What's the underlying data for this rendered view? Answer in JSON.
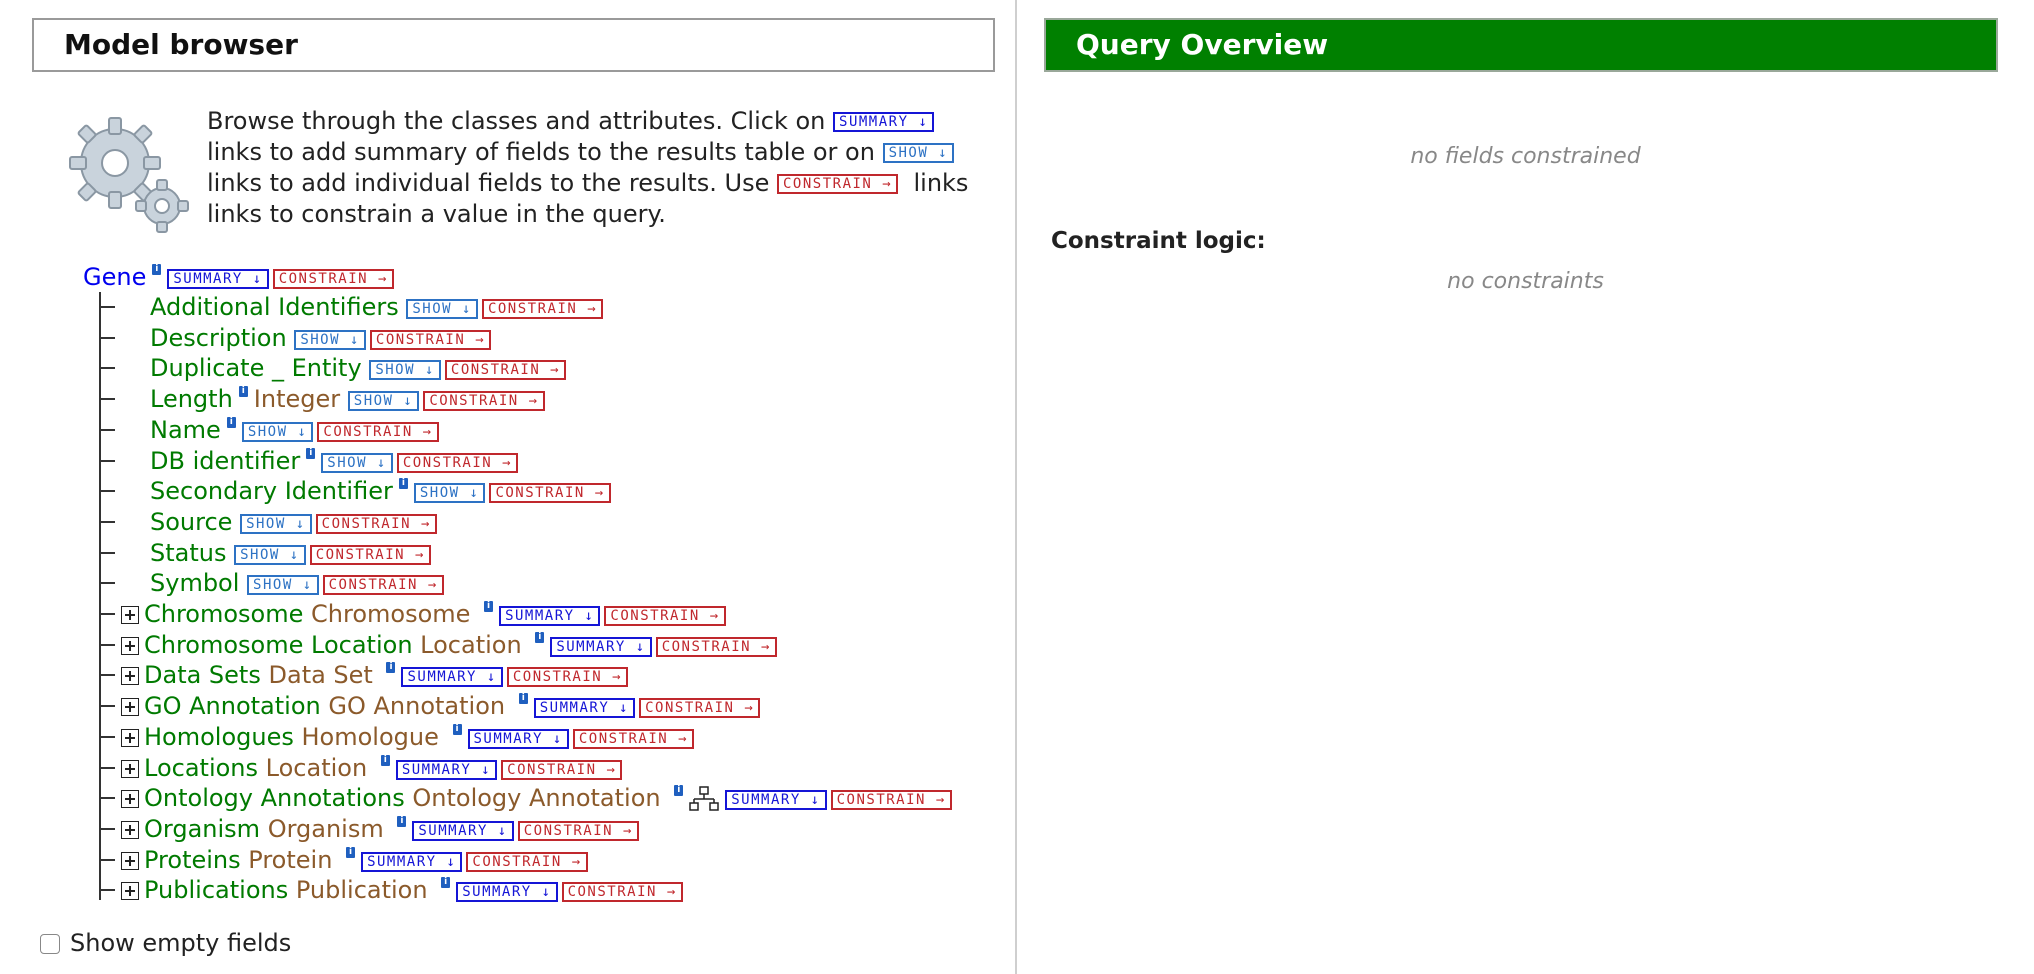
{
  "model_browser": {
    "title": "Model browser",
    "intro": {
      "part1": "Browse through the classes and attributes. Click on",
      "part2": "links to add summary of fields to the results table or on",
      "part3": "links to add individual fields to the results. Use",
      "part4": "links to constrain a value in the query."
    },
    "chips": {
      "summary": "SUMMARY ↓",
      "show": "SHOW ↓",
      "constrain": "CONSTRAIN →"
    },
    "root": {
      "label": "Gene"
    },
    "attributes": [
      {
        "name": "Additional Identifiers",
        "type": "",
        "info": false
      },
      {
        "name": "Description",
        "type": "",
        "info": false
      },
      {
        "name": "Duplicate _ Entity",
        "type": "",
        "info": false
      },
      {
        "name": "Length",
        "type": "Integer",
        "info": true
      },
      {
        "name": "Name",
        "type": "",
        "info": true
      },
      {
        "name": "DB identifier",
        "type": "",
        "info": true
      },
      {
        "name": "Secondary Identifier",
        "type": "",
        "info": true
      },
      {
        "name": "Source",
        "type": "",
        "info": false
      },
      {
        "name": "Status",
        "type": "",
        "info": false
      },
      {
        "name": "Symbol",
        "type": "",
        "info": false
      }
    ],
    "references": [
      {
        "name": "Chromosome",
        "type": "Chromosome",
        "tree_icon": false
      },
      {
        "name": "Chromosome Location",
        "type": "Location",
        "tree_icon": false
      },
      {
        "name": "Data Sets",
        "type": "Data Set",
        "tree_icon": false
      },
      {
        "name": "GO Annotation",
        "type": "GO Annotation",
        "tree_icon": false
      },
      {
        "name": "Homologues",
        "type": "Homologue",
        "tree_icon": false
      },
      {
        "name": "Locations",
        "type": "Location",
        "tree_icon": false
      },
      {
        "name": "Ontology Annotations",
        "type": "Ontology Annotation",
        "tree_icon": true
      },
      {
        "name": "Organism",
        "type": "Organism",
        "tree_icon": false
      },
      {
        "name": "Proteins",
        "type": "Protein",
        "tree_icon": false
      },
      {
        "name": "Publications",
        "type": "Publication",
        "tree_icon": false
      }
    ],
    "show_empty_label": "Show empty fields",
    "show_empty_checked": false
  },
  "query_overview": {
    "title": "Query Overview",
    "no_fields": "no fields constrained",
    "logic_label": "Constraint logic:",
    "no_constraints": "no constraints"
  },
  "colors": {
    "header_green": "#008000",
    "root_blue": "#0000ee",
    "field_green": "#007a00",
    "type_brown": "#8b5a2b",
    "summary_blue": "#1515d6",
    "show_blue": "#2d72c4",
    "constrain_red": "#c0282d"
  }
}
